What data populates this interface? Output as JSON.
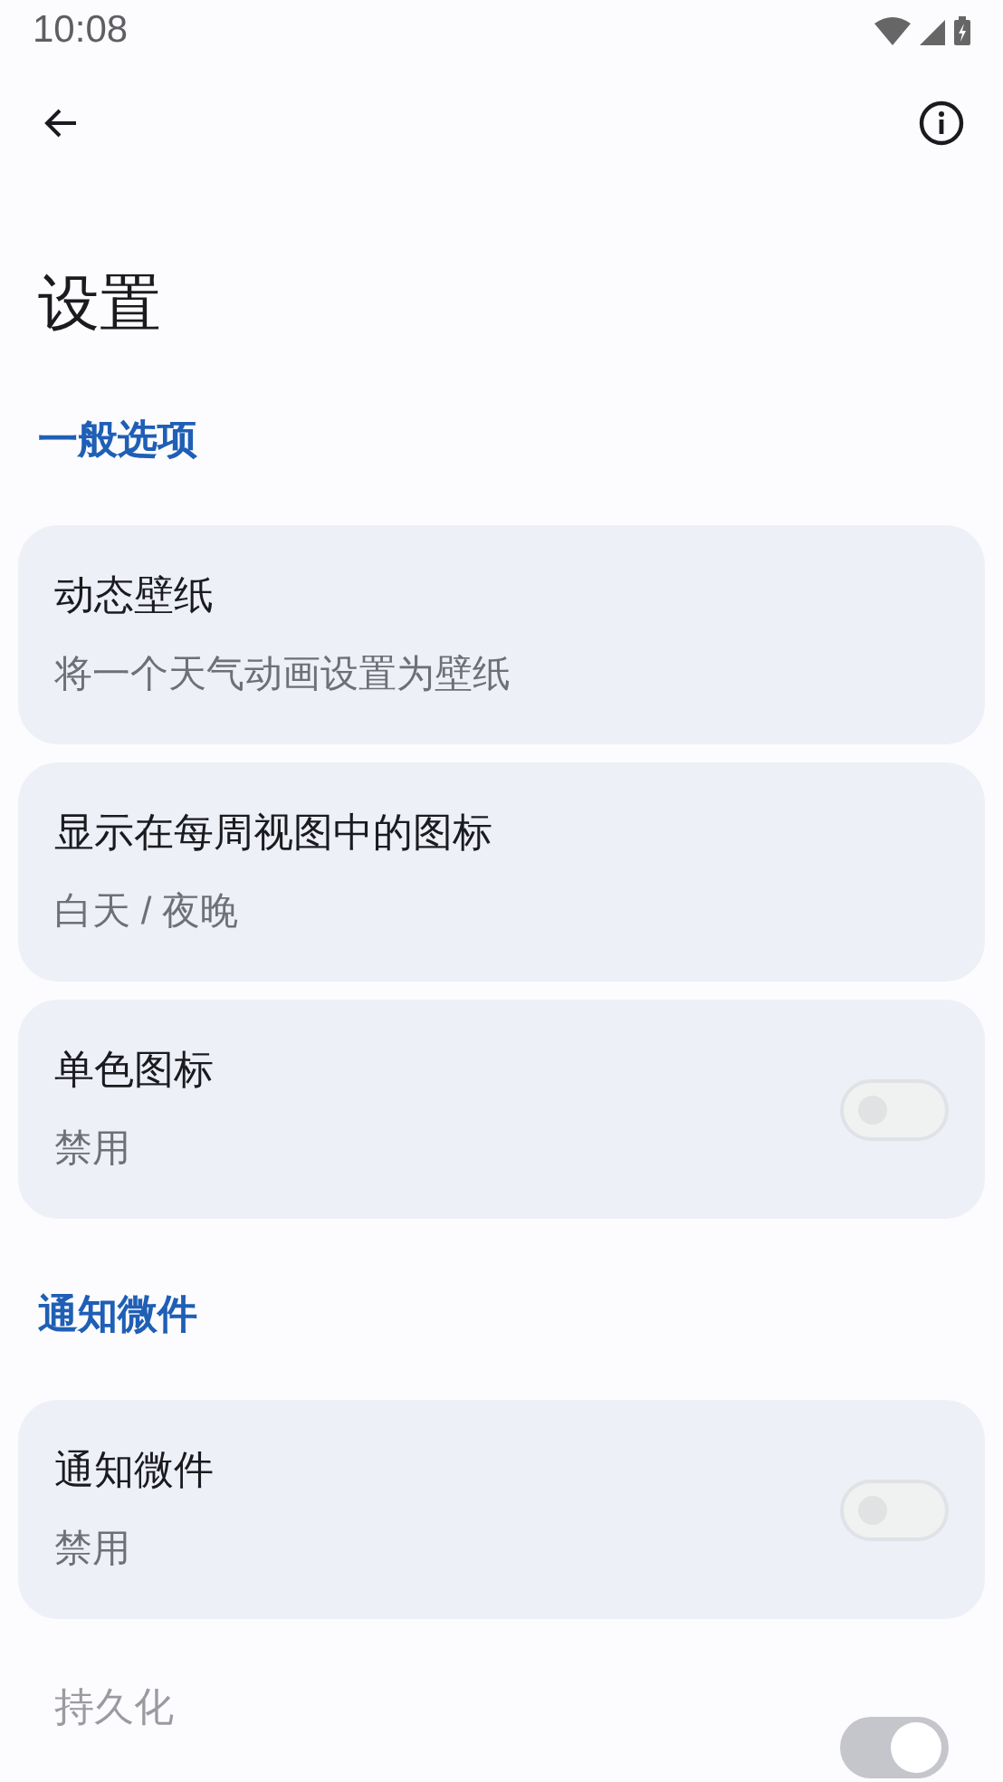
{
  "status_bar": {
    "time": "10:08"
  },
  "title": "设置",
  "sections": [
    {
      "header": "一般选项",
      "items": [
        {
          "kind": "text",
          "title": "动态壁纸",
          "subtitle": "将一个天气动画设置为壁纸",
          "disabled": false
        },
        {
          "kind": "text",
          "title": "显示在每周视图中的图标",
          "subtitle": "白天 / 夜晚",
          "disabled": false
        },
        {
          "kind": "toggle",
          "title": "单色图标",
          "subtitle": "禁用",
          "on": false,
          "disabled": false
        }
      ]
    },
    {
      "header": "通知微件",
      "items": [
        {
          "kind": "toggle",
          "title": "通知微件",
          "subtitle": "禁用",
          "on": false,
          "disabled": false
        },
        {
          "kind": "toggle",
          "title": "持久化",
          "on": true,
          "disabled": true
        }
      ]
    }
  ]
}
